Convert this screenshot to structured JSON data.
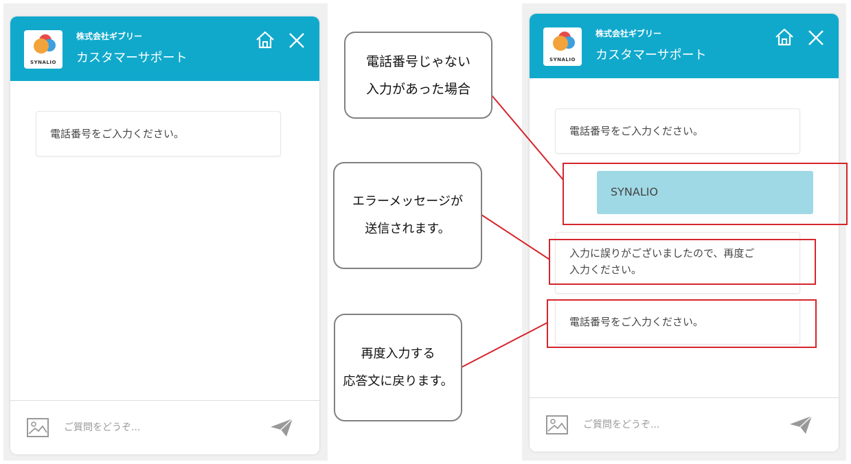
{
  "widget_left": {
    "company": "株式会社ギブリー",
    "title": "カスタマーサポート",
    "logo_text": "SYNALIO",
    "messages": [
      "電話番号をご入力ください。"
    ],
    "input_placeholder": "ご質問をどうぞ..."
  },
  "widget_right": {
    "company": "株式会社ギブリー",
    "title": "カスタマーサポート",
    "logo_text": "SYNALIO",
    "bot_message_1": "電話番号をご入力ください。",
    "user_message": "SYNALIO",
    "error_message_line1": "入力に誤りがございましたので、再度ご",
    "error_message_line2": "入力ください。",
    "bot_message_2": "電話番号をご入力ください。",
    "input_placeholder": "ご質問をどうぞ..."
  },
  "callouts": {
    "invalid_input": [
      "電話番号じゃない",
      "入力があった場合"
    ],
    "error_sent": [
      "エラーメッセージが",
      "送信されます。"
    ],
    "retry": [
      "再度入力する",
      "応答文に戻ります。"
    ]
  },
  "colors": {
    "header": "#10a9cc",
    "user_bubble": "#a0d9e6",
    "highlight_red": "#d5242b"
  },
  "icons": {
    "home": "home-icon",
    "close": "close-icon",
    "image": "image-icon",
    "send": "send-icon"
  }
}
